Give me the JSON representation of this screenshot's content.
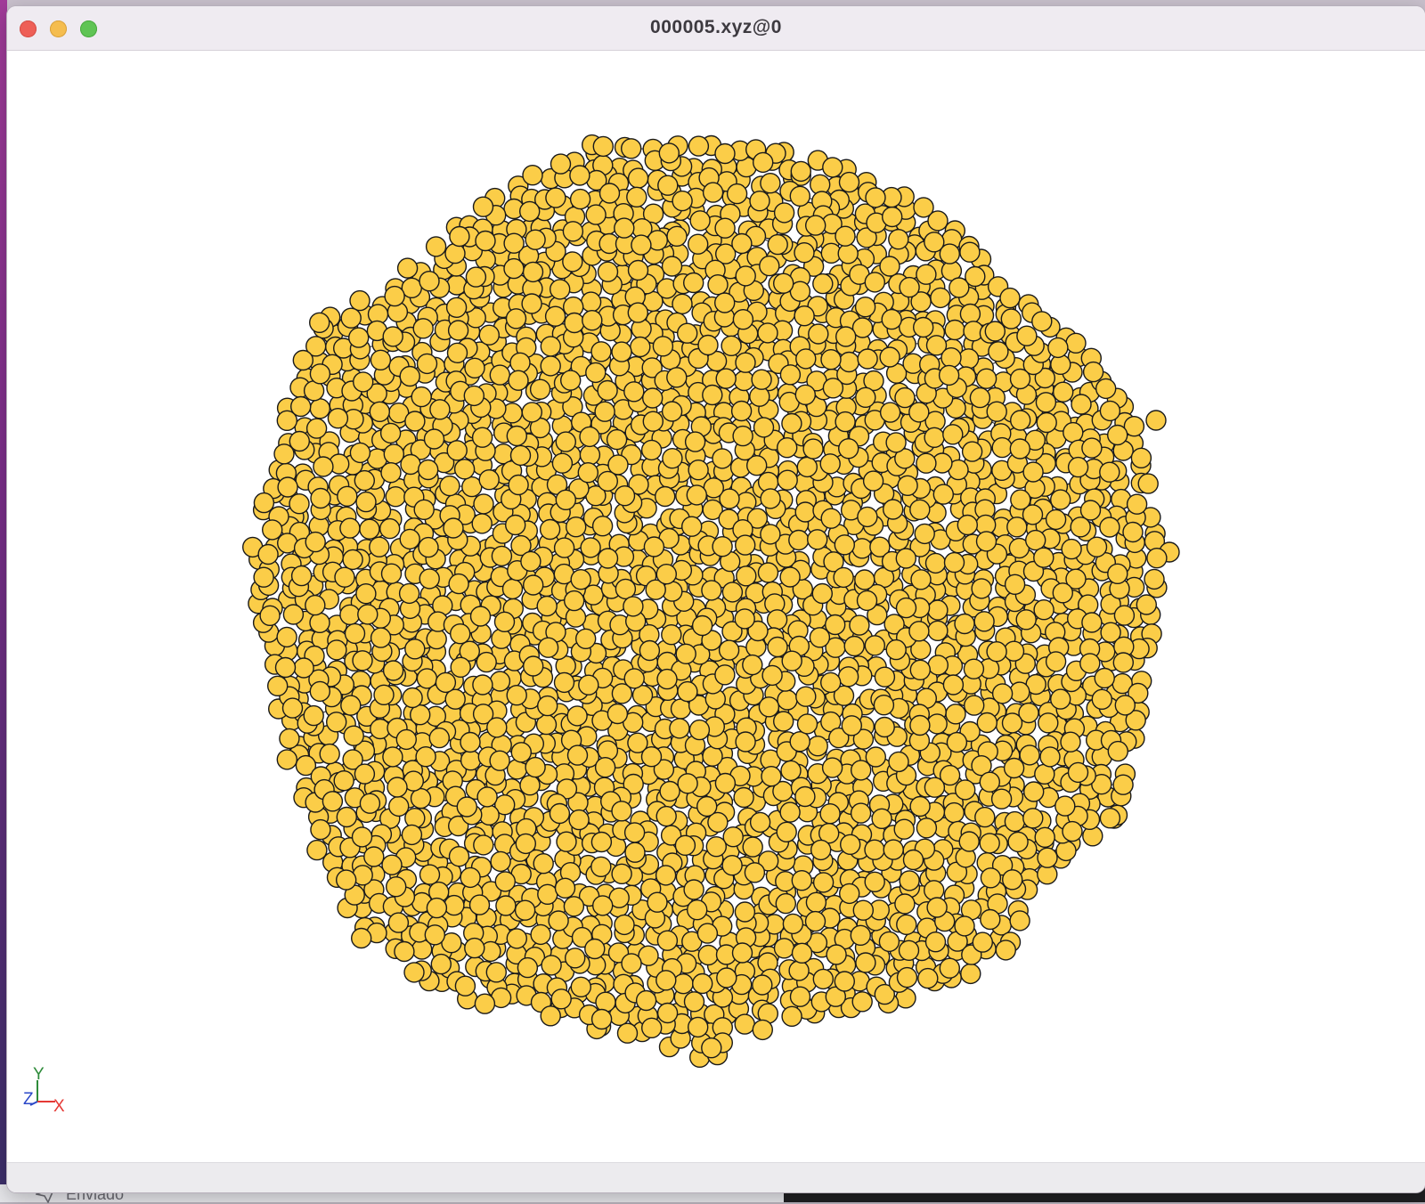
{
  "window": {
    "title": "000005.xyz@0"
  },
  "background_app": {
    "sidebar_item": "Enviado"
  },
  "structure": {
    "atom_color": "#fbcd48",
    "atom_outline_color": "#1a1a1a",
    "bond_color": "#222222"
  },
  "axes": {
    "x_label": "X",
    "y_label": "Y",
    "z_label": "Z",
    "x_color": "#e53935",
    "y_color": "#2e8b3a",
    "z_color": "#2b48c8"
  },
  "colors": {
    "traffic_close": "#ee5f57",
    "traffic_minimize": "#f5bd4f",
    "traffic_maximize": "#5fc454"
  }
}
